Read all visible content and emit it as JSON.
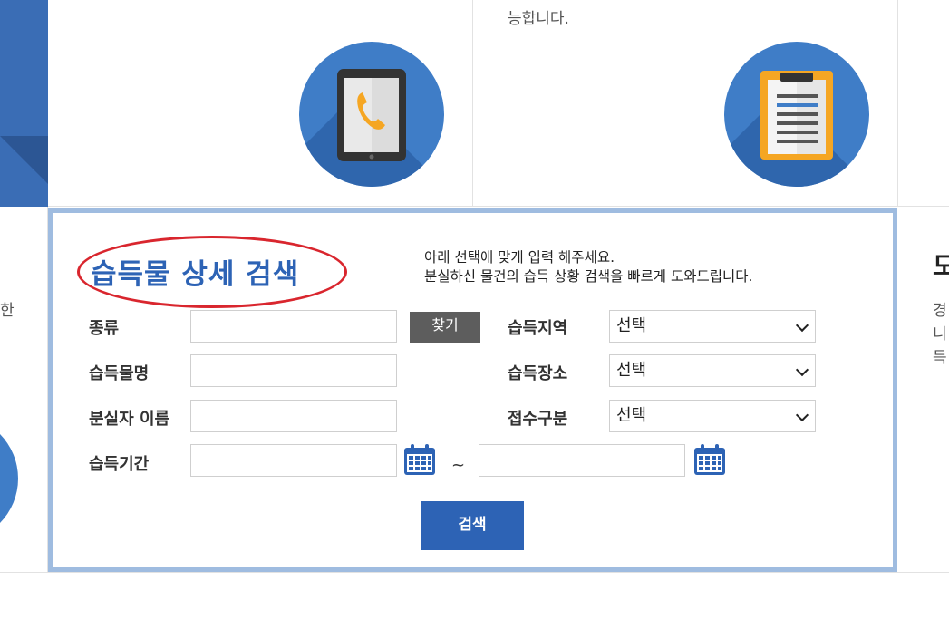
{
  "top_cards": {
    "card_b_text": "능합니다."
  },
  "left_fragment": {
    "text": "한"
  },
  "right_fragment": {
    "title": "도",
    "lines": [
      "경",
      "니",
      "득"
    ]
  },
  "search": {
    "title": "습득물 상세 검색",
    "description_line1": "아래 선택에 맞게 입력 해주세요.",
    "description_line2": "분실하신 물건의 습득 상황 검색을 빠르게 도와드립니다.",
    "labels": {
      "type": "종류",
      "item_name": "습득물명",
      "owner_name": "분실자 이름",
      "period": "습득기간",
      "region": "습득지역",
      "place": "습득장소",
      "category": "접수구분"
    },
    "find_button": "찾기",
    "selects": {
      "region": "선택",
      "place": "선택",
      "category": "선택"
    },
    "range_separator": "~",
    "submit_button": "검색"
  },
  "colors": {
    "brand_blue": "#2d63b5",
    "box_border": "#9fbce0",
    "highlight_red": "#d9262e",
    "icon_circle": "#3f7dc7"
  },
  "icons": [
    "tablet-phone-icon",
    "clipboard-icon",
    "calendar-icon"
  ]
}
